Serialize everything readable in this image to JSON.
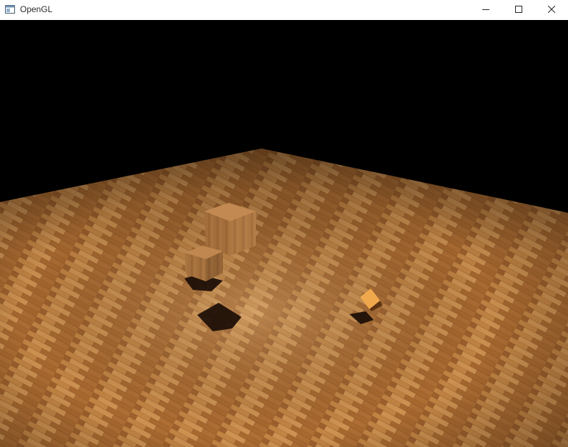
{
  "window": {
    "title": "OpenGL",
    "icon": "opengl-app-icon",
    "controls": [
      "minimize-icon",
      "maximize-icon",
      "close-icon"
    ]
  },
  "scene": {
    "background_color": "#000000",
    "floor_color": "#b8743a",
    "floor_texture": "wood-planks",
    "objects": [
      "large-wooden-cube",
      "small-wooden-cube",
      "tiny-lit-cube"
    ],
    "shadows": 3
  }
}
